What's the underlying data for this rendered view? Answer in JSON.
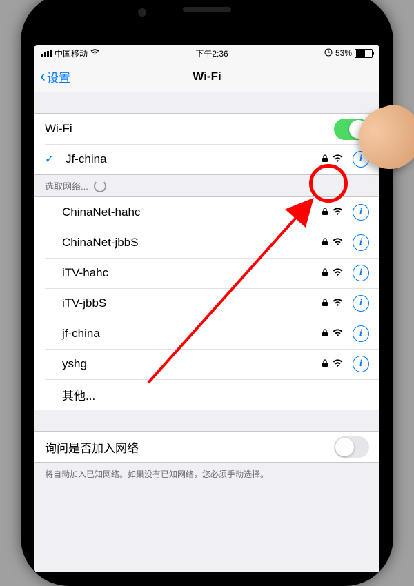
{
  "status_bar": {
    "carrier": "中国移动",
    "time": "下午2:36",
    "battery": "53%"
  },
  "nav": {
    "back": "设置",
    "title": "Wi-Fi"
  },
  "wifi_toggle_label": "Wi-Fi",
  "connected": {
    "name": "Jf-china"
  },
  "choose_network_label": "选取网络...",
  "networks": [
    {
      "name": "ChinaNet-hahc"
    },
    {
      "name": "ChinaNet-jbbS"
    },
    {
      "name": "iTV-hahc"
    },
    {
      "name": "iTV-jbbS"
    },
    {
      "name": "jf-china"
    },
    {
      "name": "yshg"
    }
  ],
  "other_label": "其他...",
  "ask_join_label": "询问是否加入网络",
  "footer_note": "将自动加入已知网络。如果没有已知网络，您必须手动选择。"
}
